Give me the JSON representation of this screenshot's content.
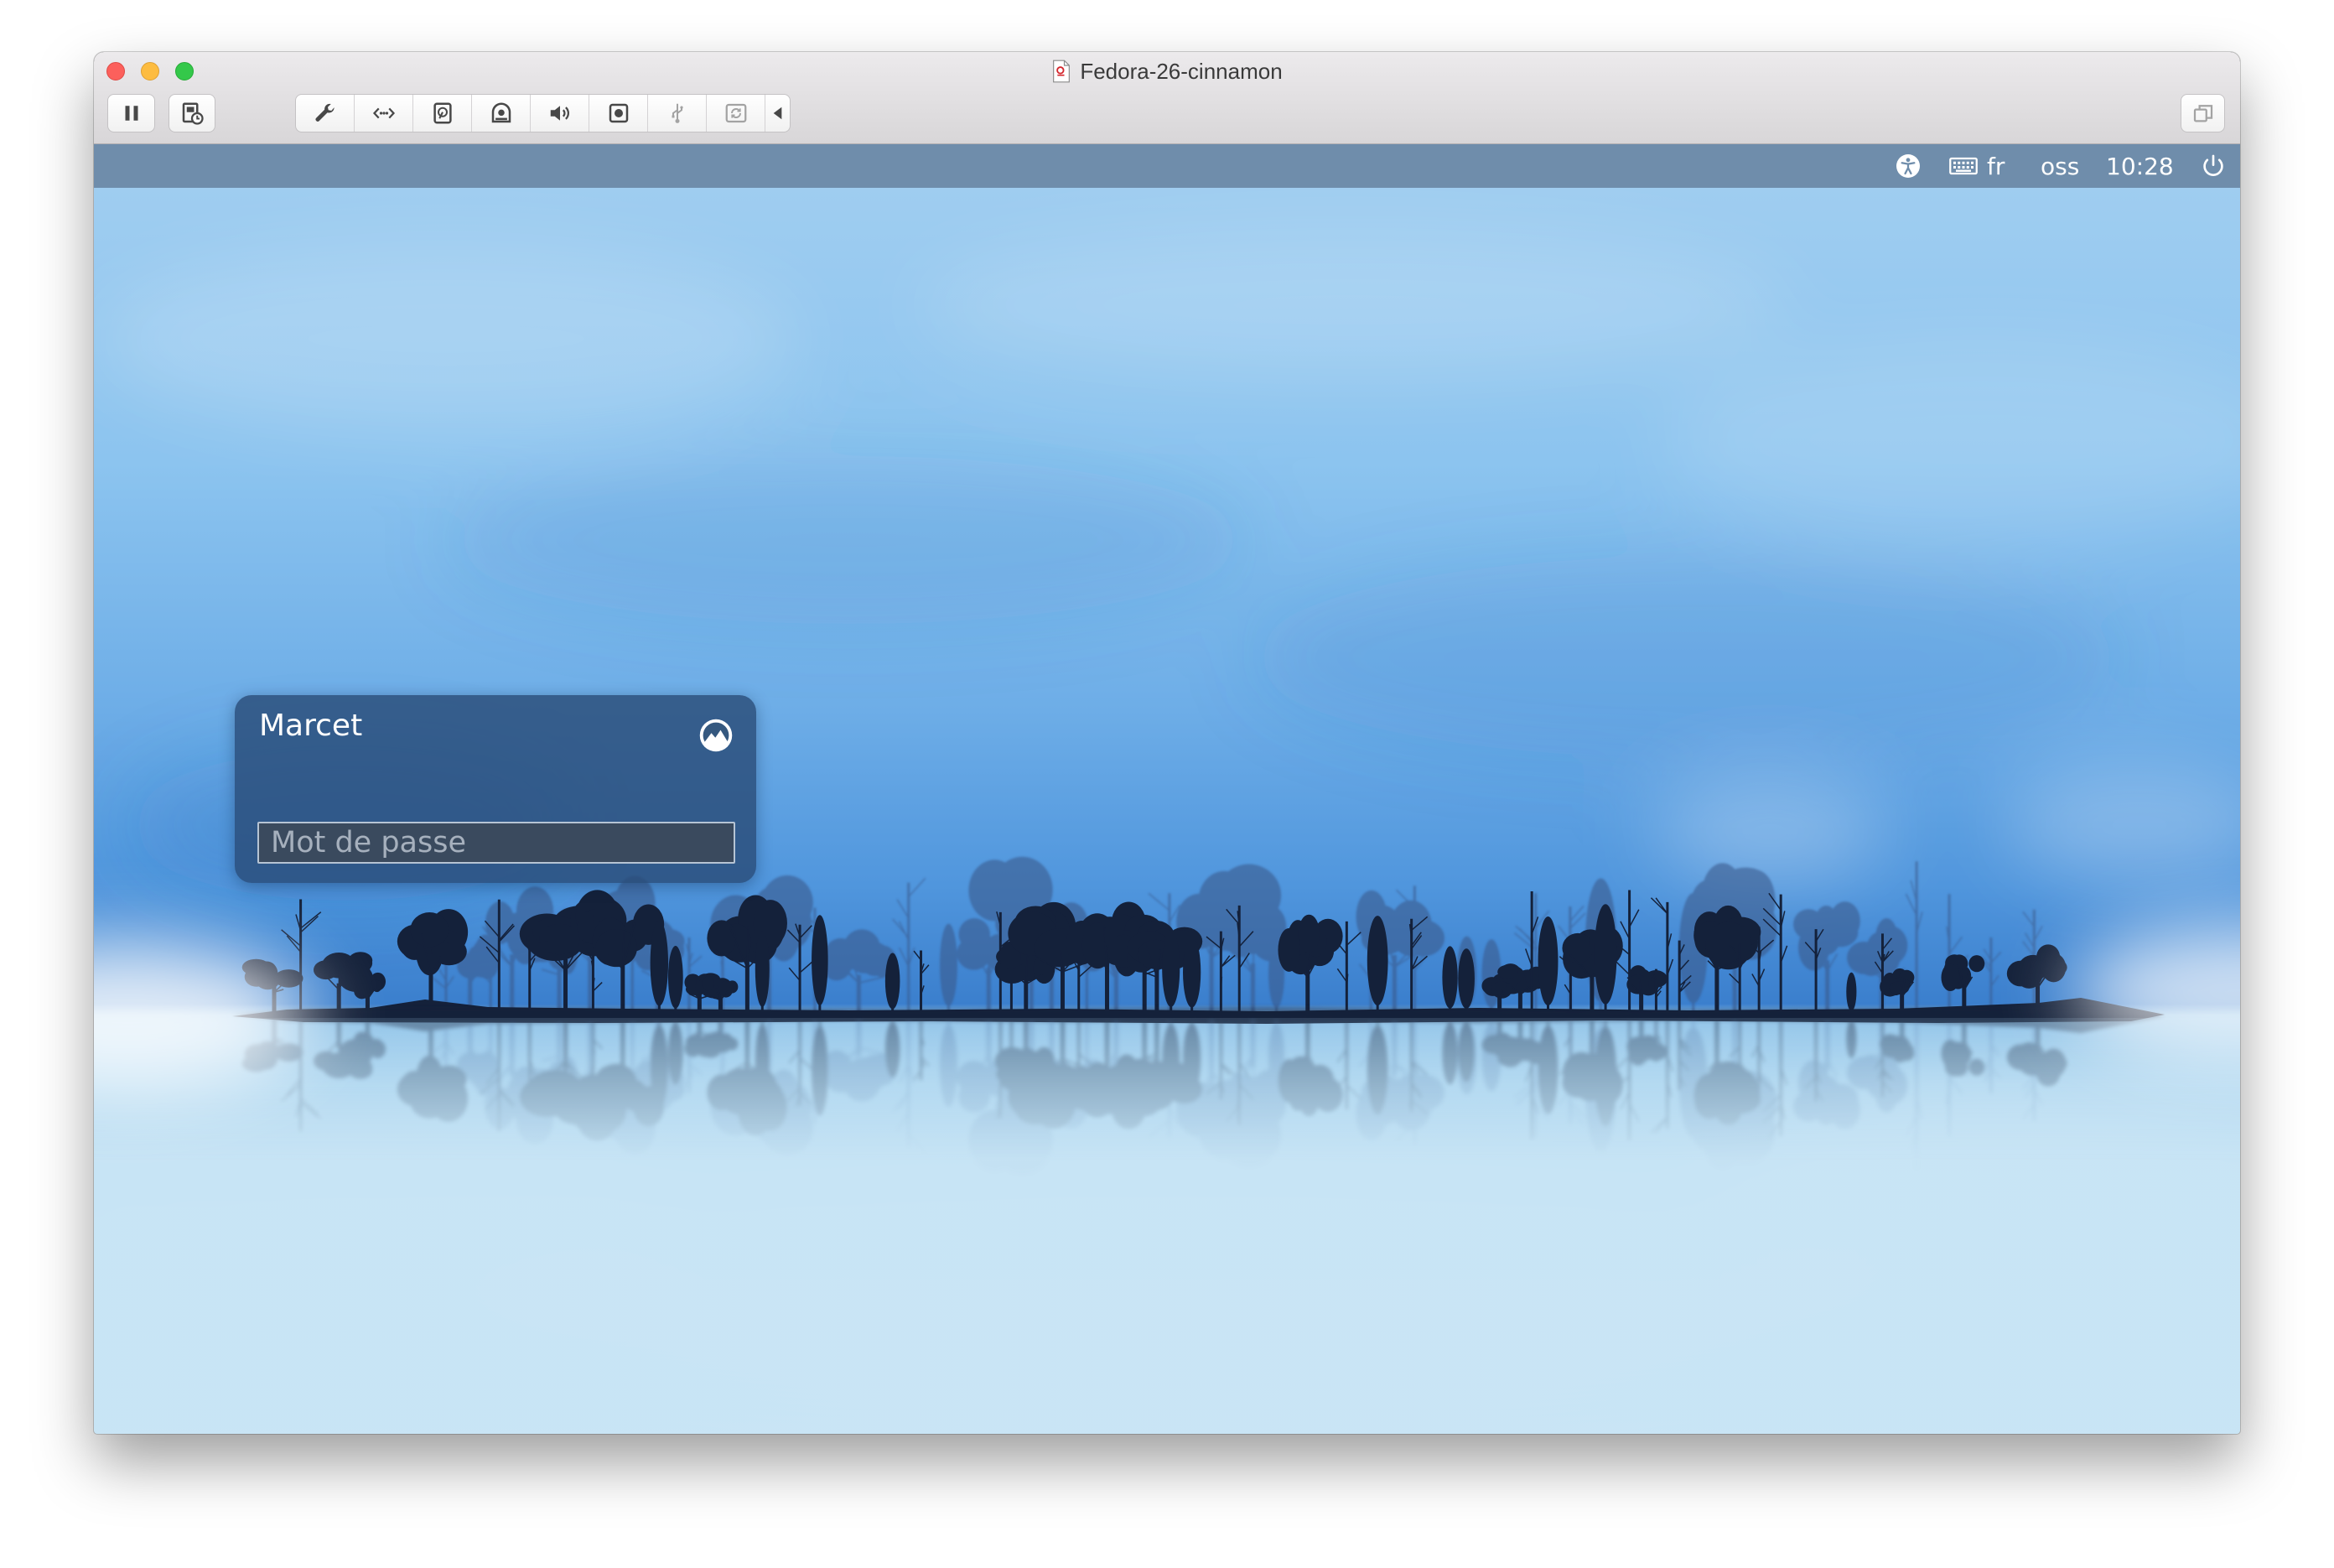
{
  "window": {
    "title": "Fedora-26-cinnamon",
    "title_icon": "vm-document-icon",
    "controls": [
      "close-icon",
      "minimize-icon",
      "zoom-icon"
    ]
  },
  "toolbar": {
    "left_buttons": [
      {
        "icon": "pause-icon"
      },
      {
        "icon": "snapshot-icon"
      }
    ],
    "device_buttons": [
      {
        "icon": "wrench-icon",
        "enabled": true
      },
      {
        "icon": "network-icon",
        "enabled": true
      },
      {
        "icon": "hard-disk-icon",
        "enabled": true
      },
      {
        "icon": "optical-drive-icon",
        "enabled": true
      },
      {
        "icon": "speaker-icon",
        "enabled": true
      },
      {
        "icon": "camera-icon",
        "enabled": true
      },
      {
        "icon": "usb-icon",
        "enabled": false
      },
      {
        "icon": "shared-folder-icon",
        "enabled": false
      },
      {
        "icon": "collapse-arrow-icon",
        "enabled": true
      }
    ],
    "right_button": {
      "icon": "restore-window-icon"
    }
  },
  "panel": {
    "accessibility_icon": "accessibility-icon",
    "keyboard_icon": "keyboard-icon",
    "keyboard_layout": "fr",
    "user": "oss",
    "clock": "10:28",
    "power_icon": "power-icon"
  },
  "login": {
    "username": "Marcet",
    "password_placeholder": "Mot de passe",
    "session_icon": "cinnamon-session-icon"
  },
  "colors": {
    "traffic_close": "#fc605c",
    "traffic_minimize": "#fdbc40",
    "traffic_zoom": "#34c84a",
    "panel": "#6f8dab",
    "login_box": "#284a76",
    "sky_top": "#9fcdf0",
    "sky_horizon": "#3b7fcd",
    "water_bottom": "#eef7fd",
    "tree_silhouette": "#14213a"
  }
}
